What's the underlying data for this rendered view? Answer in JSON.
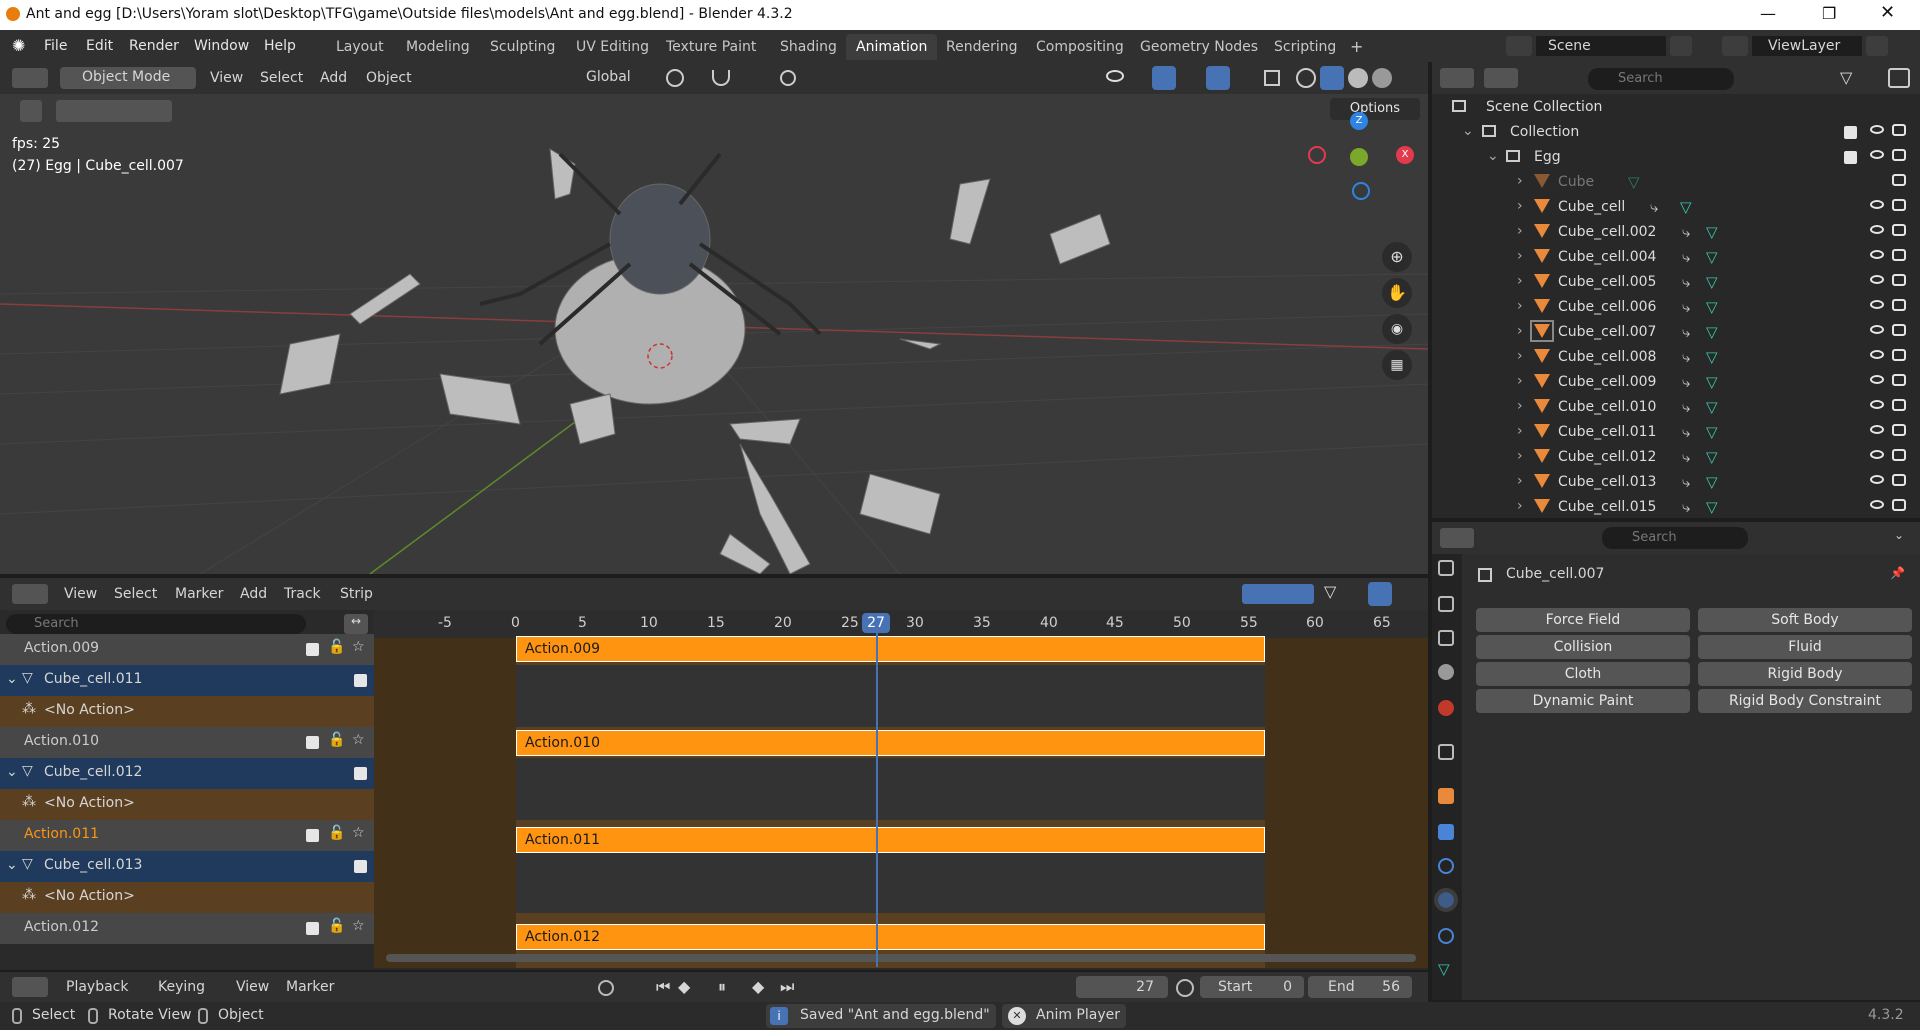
{
  "titlebar": {
    "title": "Ant and egg [D:\\Users\\Yoram slot\\Desktop\\TFG\\game\\Outside files\\models\\Ant and egg.blend] - Blender 4.3.2"
  },
  "menu": [
    "File",
    "Edit",
    "Render",
    "Window",
    "Help"
  ],
  "workspaces": [
    "Layout",
    "Modeling",
    "Sculpting",
    "UV Editing",
    "Texture Paint",
    "Shading",
    "Animation",
    "Rendering",
    "Compositing",
    "Geometry Nodes",
    "Scripting"
  ],
  "active_workspace": "Animation",
  "scene": {
    "name": "Scene",
    "view_layer": "ViewLayer"
  },
  "viewport": {
    "mode": "Object Mode",
    "menus": [
      "View",
      "Select",
      "Add",
      "Object"
    ],
    "orientation": "Global",
    "options_label": "Options",
    "fps": "fps: 25",
    "info": "(27) Egg | Cube_cell.007"
  },
  "outliner": {
    "search_placeholder": "Search",
    "scene_collection": "Scene Collection",
    "collection": "Collection",
    "egg": "Egg",
    "items": [
      "Cube",
      "Cube_cell",
      "Cube_cell.002",
      "Cube_cell.004",
      "Cube_cell.005",
      "Cube_cell.006",
      "Cube_cell.007",
      "Cube_cell.008",
      "Cube_cell.009",
      "Cube_cell.010",
      "Cube_cell.011",
      "Cube_cell.012",
      "Cube_cell.013",
      "Cube_cell.015"
    ]
  },
  "properties": {
    "search_placeholder": "Search",
    "object": "Cube_cell.007",
    "buttons": [
      "Force Field",
      "Soft Body",
      "Collision",
      "Fluid",
      "Cloth",
      "Rigid Body",
      "Dynamic Paint",
      "Rigid Body Constraint"
    ]
  },
  "nla": {
    "menus": [
      "View",
      "Select",
      "Marker",
      "Add",
      "Track",
      "Strip"
    ],
    "search_placeholder": "Search",
    "ticks": [
      "-5",
      "0",
      "5",
      "10",
      "15",
      "20",
      "25",
      "27",
      "30",
      "35",
      "40",
      "45",
      "50",
      "55",
      "60",
      "65"
    ],
    "current_frame": "27",
    "tracks": [
      {
        "kind": "action",
        "label": "Action.009",
        "strip": "Action.009"
      },
      {
        "kind": "object",
        "label": "Cube_cell.011"
      },
      {
        "kind": "noaction",
        "label": "<No Action>"
      },
      {
        "kind": "action",
        "label": "Action.010",
        "strip": "Action.010"
      },
      {
        "kind": "object",
        "label": "Cube_cell.012"
      },
      {
        "kind": "noaction",
        "label": "<No Action>"
      },
      {
        "kind": "action",
        "label": "Action.011",
        "strip": "Action.011",
        "highlight": true
      },
      {
        "kind": "object",
        "label": "Cube_cell.013"
      },
      {
        "kind": "noaction",
        "label": "<No Action>"
      },
      {
        "kind": "action",
        "label": "Action.012",
        "strip": "Action.012"
      }
    ]
  },
  "timeline": {
    "menus": [
      "Playback",
      "Keying",
      "View",
      "Marker"
    ],
    "frame": "27",
    "start_label": "Start",
    "start": "0",
    "end_label": "End",
    "end": "56"
  },
  "statusbar": {
    "select": "Select",
    "rotate": "Rotate View",
    "object": "Object",
    "message": "Saved \"Ant and egg.blend\"",
    "anim_player": "Anim Player",
    "version": "4.3.2"
  }
}
